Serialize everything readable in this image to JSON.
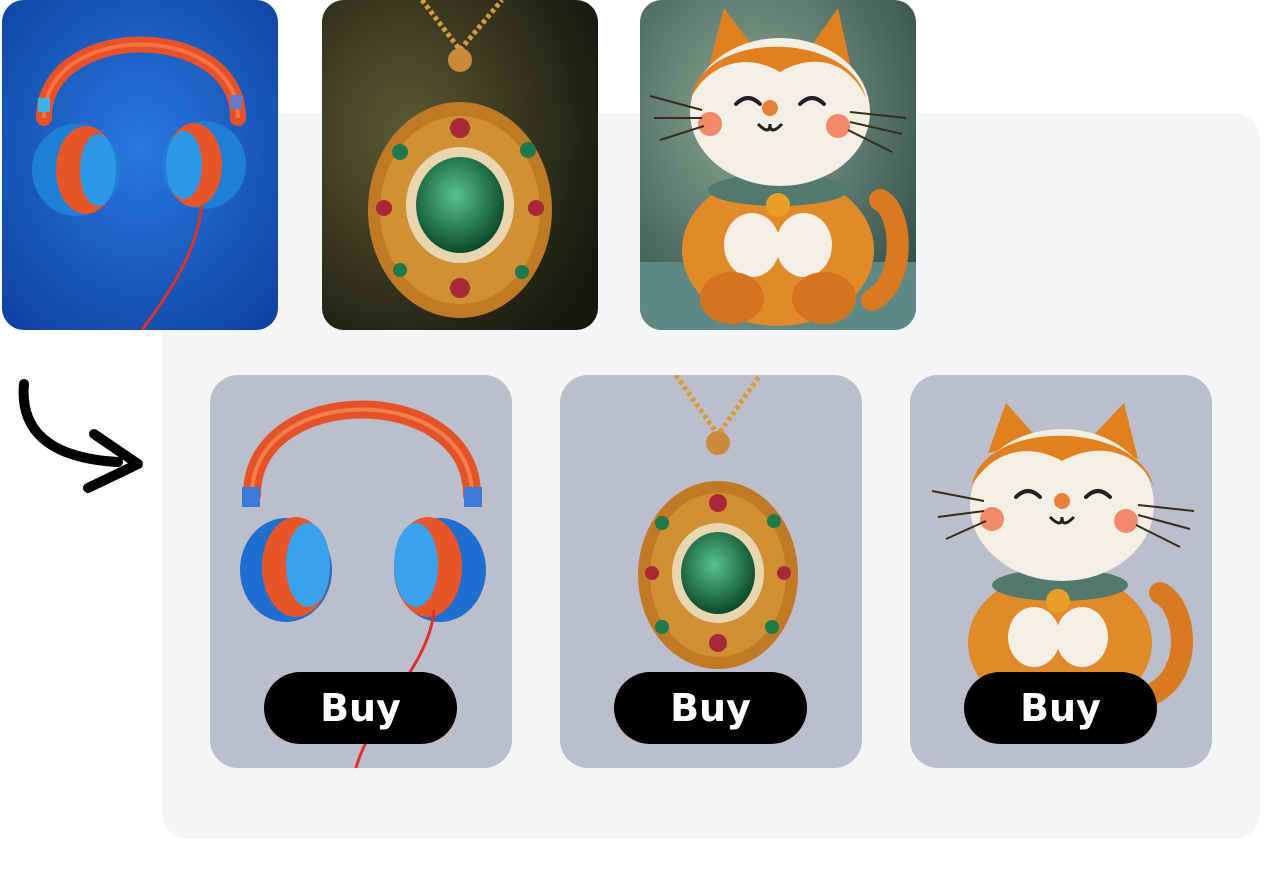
{
  "source_photos": [
    {
      "name": "headphones"
    },
    {
      "name": "pendant"
    },
    {
      "name": "felt-cat"
    }
  ],
  "cards": [
    {
      "product": "headphones",
      "buy_label": "Buy"
    },
    {
      "product": "pendant",
      "buy_label": "Buy"
    },
    {
      "product": "felt-cat",
      "buy_label": "Buy"
    }
  ],
  "colors": {
    "panel": "#f3f5f7",
    "card": "#bcbfcb",
    "button": "#000000",
    "button_text": "#ffffff"
  }
}
